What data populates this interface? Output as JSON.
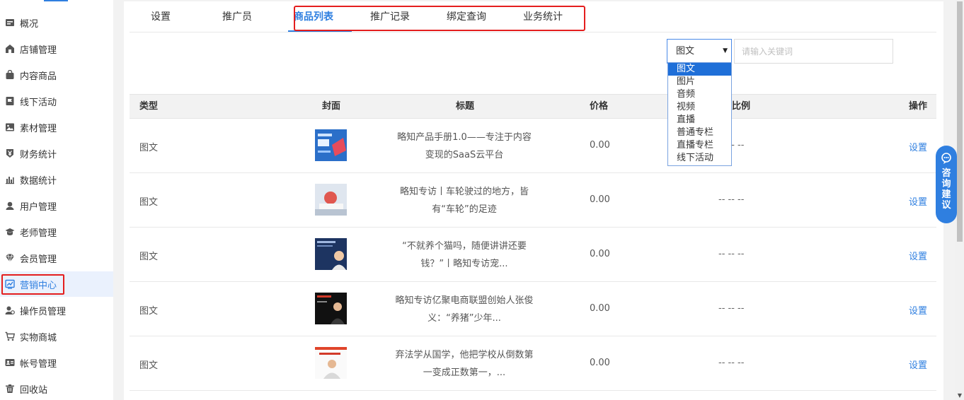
{
  "sidebar": {
    "items": [
      {
        "label": "概况",
        "icon": "overview-icon"
      },
      {
        "label": "店铺管理",
        "icon": "store-icon"
      },
      {
        "label": "内容商品",
        "icon": "bag-icon"
      },
      {
        "label": "线下活动",
        "icon": "flag-icon"
      },
      {
        "label": "素材管理",
        "icon": "image-icon"
      },
      {
        "label": "财务统计",
        "icon": "yen-icon"
      },
      {
        "label": "数据统计",
        "icon": "bar-chart-icon"
      },
      {
        "label": "用户管理",
        "icon": "user-icon"
      },
      {
        "label": "老师管理",
        "icon": "graduation-cap-icon"
      },
      {
        "label": "会员管理",
        "icon": "diamond-icon"
      },
      {
        "label": "营销中心",
        "icon": "trend-chart-icon"
      },
      {
        "label": "操作员管理",
        "icon": "operator-icon"
      },
      {
        "label": "实物商城",
        "icon": "cart-icon"
      },
      {
        "label": "帐号管理",
        "icon": "id-card-icon"
      },
      {
        "label": "回收站",
        "icon": "trash-icon"
      }
    ],
    "active_index": 10
  },
  "tabs": [
    {
      "label": "设置"
    },
    {
      "label": "推广员"
    },
    {
      "label": "商品列表"
    },
    {
      "label": "推广记录"
    },
    {
      "label": "绑定查询"
    },
    {
      "label": "业务统计"
    }
  ],
  "active_tab": 2,
  "filter": {
    "selected": "图文",
    "options": [
      "图文",
      "图片",
      "音频",
      "视频",
      "直播",
      "普通专栏",
      "直播专栏",
      "线下活动"
    ],
    "search_placeholder": "请输入关键词"
  },
  "table": {
    "headers": {
      "type": "类型",
      "cover": "封面",
      "title": "标题",
      "price": "价格",
      "ratio": "比例",
      "action": "操作"
    },
    "rows": [
      {
        "type": "图文",
        "title": "略知产品手册1.0——专注于内容变现的SaaS云平台",
        "price": "0.00",
        "ratio": "-- -- --",
        "action": "设置"
      },
      {
        "type": "图文",
        "title": "略知专访丨车轮驶过的地方，皆有“车轮”的足迹",
        "price": "0.00",
        "ratio": "-- -- --",
        "action": "设置"
      },
      {
        "type": "图文",
        "title": "“不就养个猫吗，随便讲讲还要钱？”丨略知专访宠...",
        "price": "0.00",
        "ratio": "-- -- --",
        "action": "设置"
      },
      {
        "type": "图文",
        "title": "略知专访亿聚电商联盟创始人张俊义：“养猪”少年...",
        "price": "0.00",
        "ratio": "-- -- --",
        "action": "设置"
      },
      {
        "type": "图文",
        "title": "弃法学从国学，他把学校从倒数第一变成正数第一，...",
        "price": "0.00",
        "ratio": "-- -- --",
        "action": "设置"
      }
    ]
  },
  "advisor": {
    "label": "咨询建议"
  },
  "colors": {
    "accent": "#2f7fe0",
    "highlight": "#e41e1e"
  }
}
